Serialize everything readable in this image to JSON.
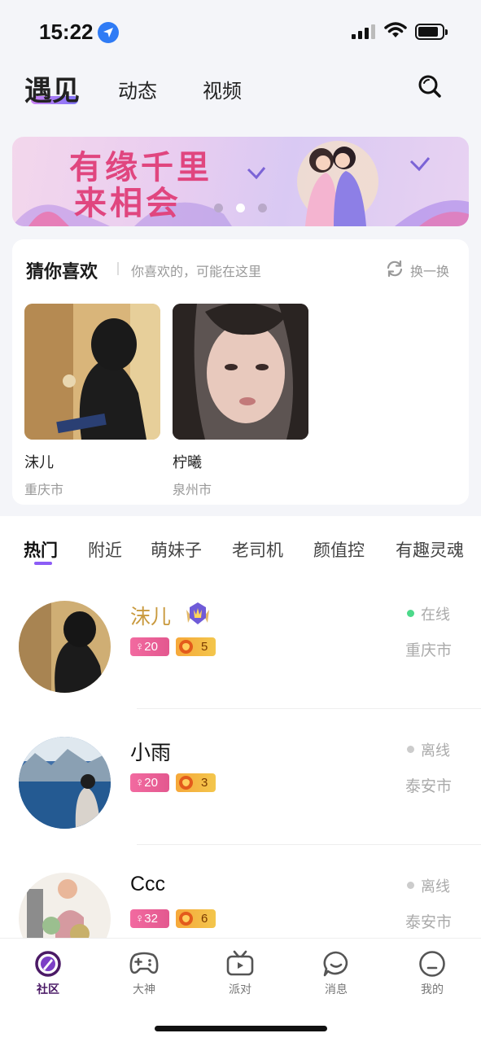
{
  "status_bar": {
    "time": "15:22"
  },
  "header": {
    "tabs": [
      {
        "label": "遇见",
        "active": true
      },
      {
        "label": "动态"
      },
      {
        "label": "视频"
      }
    ]
  },
  "banner": {
    "line1": "有缘千里",
    "line2": "来相会",
    "dot_count": 3,
    "active_dot": 1
  },
  "guess": {
    "title": "猜你喜欢",
    "subtitle": "你喜欢的，可能在这里",
    "refresh_label": "换一换",
    "items": [
      {
        "name": "沫儿",
        "city": "重庆市"
      },
      {
        "name": "柠曦",
        "city": "泉州市"
      }
    ]
  },
  "categories": [
    "热门",
    "附近",
    "萌妹子",
    "老司机",
    "颜值控",
    "有趣灵魂"
  ],
  "users": [
    {
      "name": "沫儿",
      "age": "♀20",
      "level": "5",
      "status": "在线",
      "status_color": "#4cd98a",
      "city": "重庆市",
      "vip": true
    },
    {
      "name": "小雨",
      "age": "♀20",
      "level": "3",
      "status": "离线",
      "status_color": "#cccccc",
      "city": "泰安市",
      "vip": false
    },
    {
      "name": "Ccc",
      "age": "♀32",
      "level": "6",
      "status": "离线",
      "status_color": "#cccccc",
      "city": "泰安市",
      "vip": false
    }
  ],
  "bottom_nav": [
    {
      "label": "社区",
      "icon": "community-icon",
      "active": true
    },
    {
      "label": "大神",
      "icon": "gamepad-icon"
    },
    {
      "label": "派对",
      "icon": "tv-icon"
    },
    {
      "label": "消息",
      "icon": "message-icon"
    },
    {
      "label": "我的",
      "icon": "profile-icon"
    }
  ],
  "colors": {
    "accent": "#8c5cf6",
    "online": "#4cd98a",
    "vip_name": "#c99a3f",
    "banner_text": "#e0467f"
  }
}
